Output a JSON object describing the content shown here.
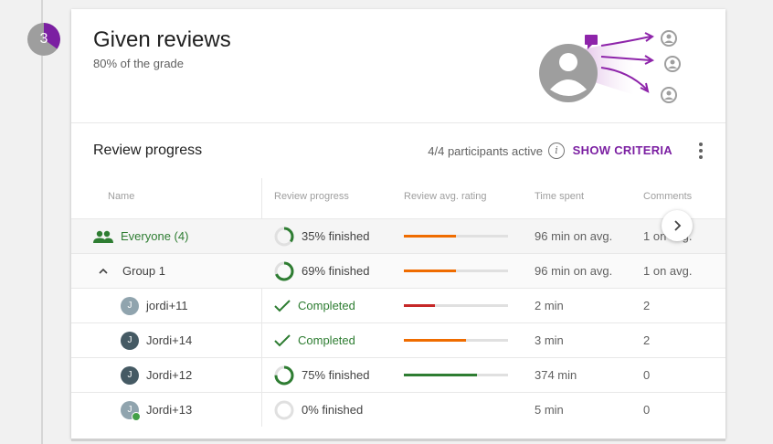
{
  "step": {
    "number": "3",
    "progress_fraction": 0.35
  },
  "card": {
    "title": "Given reviews",
    "subtitle": "80% of the grade"
  },
  "review_progress": {
    "title": "Review progress",
    "participants": "4/4 participants active",
    "info_icon_glyph": "i",
    "show_criteria_label": "SHOW CRITERIA"
  },
  "table": {
    "headers": {
      "name": "Name",
      "progress": "Review progress",
      "rating": "Review avg. rating",
      "time": "Time spent",
      "comments": "Comments"
    },
    "rows": [
      {
        "type": "everyone",
        "name": "Everyone (4)",
        "progress_text": "35% finished",
        "progress_fraction": 0.35,
        "rating_fraction": 0.5,
        "rating_color": "#ef6c00",
        "time": "96 min on avg.",
        "comments": "1 on avg."
      },
      {
        "type": "group",
        "name": "Group 1",
        "progress_text": "69% finished",
        "progress_fraction": 0.69,
        "rating_fraction": 0.5,
        "rating_color": "#ef6c00",
        "time": "96 min on avg.",
        "comments": "1 on avg."
      },
      {
        "type": "member",
        "initial": "J",
        "avatar": "light",
        "name": "jordi+11",
        "status": "completed",
        "progress_text": "Completed",
        "rating_fraction": 0.3,
        "rating_color": "#c62828",
        "time": "2 min",
        "comments": "2"
      },
      {
        "type": "member",
        "initial": "J",
        "avatar": "dark",
        "name": "Jordi+14",
        "status": "completed",
        "progress_text": "Completed",
        "rating_fraction": 0.6,
        "rating_color": "#ef6c00",
        "time": "3 min",
        "comments": "2"
      },
      {
        "type": "member",
        "initial": "J",
        "avatar": "dark",
        "name": "Jordi+12",
        "status": "in-progress",
        "progress_text": "75% finished",
        "progress_fraction": 0.75,
        "rating_fraction": 0.7,
        "rating_color": "#2e7d32",
        "time": "374 min",
        "comments": "0"
      },
      {
        "type": "member",
        "initial": "J",
        "avatar": "light",
        "online": true,
        "name": "Jordi+13",
        "status": "in-progress",
        "progress_text": "0% finished",
        "progress_fraction": 0,
        "rating_fraction": null,
        "time": "5 min",
        "comments": "0"
      }
    ]
  },
  "colors": {
    "accent": "#7b1fa2",
    "progress_green": "#2e7d32",
    "rating_orange": "#ef6c00",
    "rating_red": "#c62828"
  },
  "icons": {
    "people": "people-icon",
    "chevron_up": "chevron-up-icon",
    "check": "check-icon",
    "scroll_right": "chevron-right-icon",
    "more": "more-vert-icon"
  }
}
